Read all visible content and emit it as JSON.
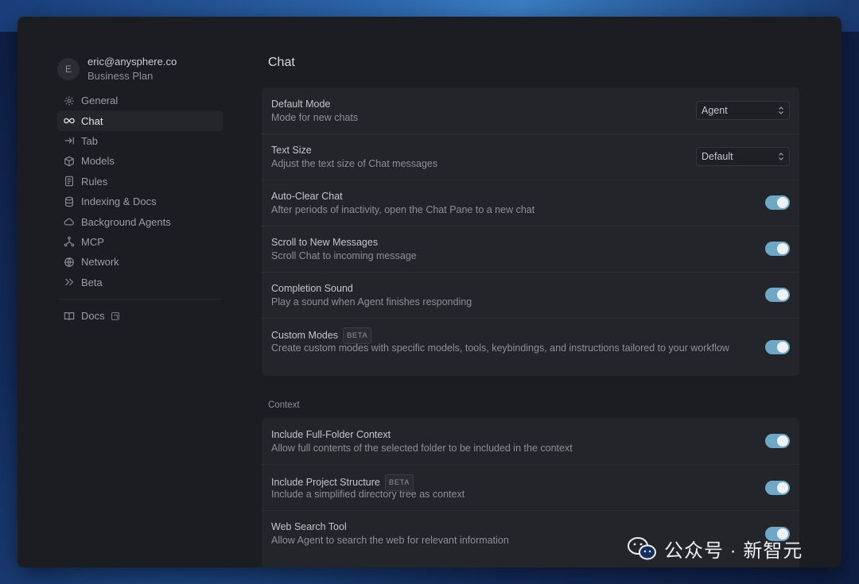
{
  "user": {
    "initial": "E",
    "email": "eric@anysphere.co",
    "plan": "Business Plan"
  },
  "sidebar": {
    "items": [
      {
        "label": "General",
        "icon": "gear-icon"
      },
      {
        "label": "Chat",
        "icon": "infinity-icon",
        "active": true
      },
      {
        "label": "Tab",
        "icon": "tab-arrow-icon"
      },
      {
        "label": "Models",
        "icon": "cube-icon"
      },
      {
        "label": "Rules",
        "icon": "document-icon"
      },
      {
        "label": "Indexing & Docs",
        "icon": "database-icon"
      },
      {
        "label": "Background Agents",
        "icon": "cloud-icon"
      },
      {
        "label": "MCP",
        "icon": "network-nodes-icon"
      },
      {
        "label": "Network",
        "icon": "globe-icon"
      },
      {
        "label": "Beta",
        "icon": "double-chevron-icon"
      }
    ],
    "docs": {
      "label": "Docs",
      "icon": "book-icon"
    }
  },
  "main": {
    "title": "Chat",
    "settings": [
      {
        "title": "Default Mode",
        "desc": "Mode for new chats",
        "control": "select",
        "value": "Agent"
      },
      {
        "title": "Text Size",
        "desc": "Adjust the text size of Chat messages",
        "control": "select",
        "value": "Default"
      },
      {
        "title": "Auto-Clear Chat",
        "desc": "After periods of inactivity, open the Chat Pane to a new chat",
        "control": "toggle",
        "on": true
      },
      {
        "title": "Scroll to New Messages",
        "desc": "Scroll Chat to incoming message",
        "control": "toggle",
        "on": true
      },
      {
        "title": "Completion Sound",
        "desc": "Play a sound when Agent finishes responding",
        "control": "toggle",
        "on": true
      },
      {
        "title": "Custom Modes",
        "badge": "BETA",
        "desc": "Create custom modes with specific models, tools, keybindings, and instructions tailored to your workflow",
        "control": "toggle",
        "on": true
      }
    ],
    "context": {
      "label": "Context",
      "settings": [
        {
          "title": "Include Full-Folder Context",
          "desc": "Allow full contents of the selected folder to be included in the context",
          "control": "toggle",
          "on": true
        },
        {
          "title": "Include Project Structure",
          "badge": "BETA",
          "desc": "Include a simplified directory tree as context",
          "control": "toggle",
          "on": true
        },
        {
          "title": "Web Search Tool",
          "desc": "Allow Agent to search the web for relevant information",
          "control": "toggle",
          "on": true
        }
      ]
    }
  },
  "watermark": {
    "text": "公众号 · 新智元"
  },
  "colors": {
    "toggle_on": "#6fa7c5",
    "window_bg": "#1b1d22",
    "card_bg": "#23252a"
  }
}
